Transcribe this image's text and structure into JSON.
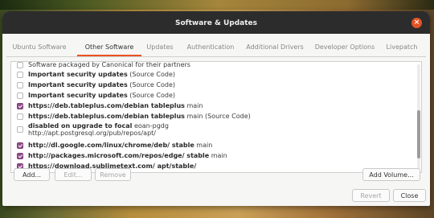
{
  "window": {
    "title": "Software & Updates",
    "close_glyph": "×"
  },
  "tabs": [
    {
      "label": "Ubuntu Software"
    },
    {
      "label": "Other Software"
    },
    {
      "label": "Updates"
    },
    {
      "label": "Authentication"
    },
    {
      "label": "Additional Drivers"
    },
    {
      "label": "Developer Options"
    },
    {
      "label": "Livepatch"
    }
  ],
  "active_tab": "Other Software",
  "sources": [
    {
      "checked": false,
      "bold": "",
      "rest": "Software packaged by Canonical for their partners"
    },
    {
      "checked": false,
      "bold": "Important security updates",
      "rest": " (Source Code)"
    },
    {
      "checked": false,
      "bold": "Important security updates",
      "rest": " (Source Code)"
    },
    {
      "checked": false,
      "bold": "Important security updates",
      "rest": " (Source Code)"
    },
    {
      "checked": true,
      "bold": "https://deb.tableplus.com/debian tableplus",
      "rest": " main"
    },
    {
      "checked": false,
      "bold": "https://deb.tableplus.com/debian tableplus",
      "rest": " main (Source Code)"
    },
    {
      "checked": false,
      "bold": "disabled on upgrade to focal",
      "rest": " eoan-pgdg",
      "line2": "http://apt.postgresql.org/pub/repos/apt/"
    },
    {
      "checked": true,
      "bold": "http://dl.google.com/linux/chrome/deb/ stable",
      "rest": " main"
    },
    {
      "checked": true,
      "bold": "http://packages.microsoft.com/repos/edge/ stable",
      "rest": " main"
    },
    {
      "checked": true,
      "bold": "https://download.sublimetext.com/ apt/stable/",
      "rest": ""
    }
  ],
  "buttons": {
    "add": "Add...",
    "edit": "Edit...",
    "remove": "Remove",
    "add_volume": "Add Volume...",
    "revert": "Revert",
    "close": "Close"
  },
  "colors": {
    "accent": "#e95420",
    "checkbox": "#924d8b",
    "titlebar": "#2c2c2c"
  }
}
